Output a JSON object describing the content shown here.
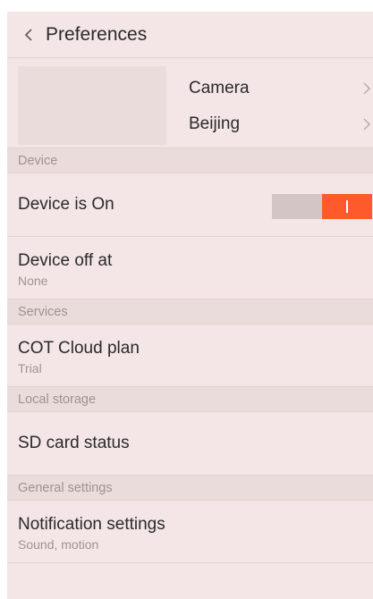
{
  "header": {
    "title": "Preferences",
    "back_icon": "chevron-left-icon"
  },
  "device_card": {
    "rows": [
      {
        "label": "Camera",
        "icon": "chevron-right-icon"
      },
      {
        "label": "Beijing",
        "icon": "chevron-right-icon"
      }
    ]
  },
  "sections": {
    "device": "Device",
    "services": "Services",
    "local_storage": "Local storage",
    "general_settings": "General settings"
  },
  "rows": {
    "device_on": {
      "title": "Device is On",
      "toggle_on": true
    },
    "device_off_at": {
      "title": "Device off at",
      "subtitle": "None"
    },
    "cloud_plan": {
      "title": "COT Cloud plan",
      "subtitle": "Trial"
    },
    "sd_card": {
      "title": "SD card status"
    },
    "notifications": {
      "title": "Notification settings",
      "subtitle": "Sound, motion"
    }
  },
  "colors": {
    "background": "#f4e6e6",
    "section_background": "#ebdcdc",
    "accent": "#ff5a2b",
    "toggle_track": "#d3c5c5",
    "primary_text": "#2a2a2a",
    "secondary_text": "#a09292"
  }
}
